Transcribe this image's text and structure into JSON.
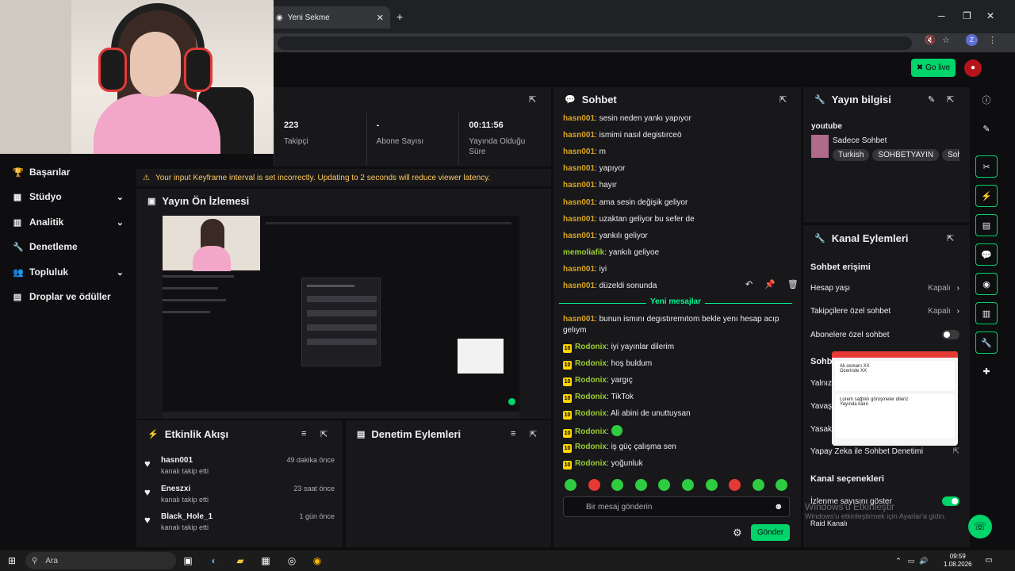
{
  "browser": {
    "tab_title": "Yeni Sekme",
    "profile_initial": "Z"
  },
  "topnav": {
    "go_live_label": "Go live"
  },
  "sidebar": {
    "items": [
      {
        "label": "Başarılar",
        "icon": "trophy-icon",
        "expandable": false
      },
      {
        "label": "Stüdyo",
        "icon": "studio-icon",
        "expandable": true
      },
      {
        "label": "Analitik",
        "icon": "chart-icon",
        "expandable": true
      },
      {
        "label": "Denetleme",
        "icon": "wrench-icon",
        "expandable": false
      },
      {
        "label": "Topluluk",
        "icon": "people-icon",
        "expandable": true
      },
      {
        "label": "Droplar ve ödüller",
        "icon": "drops-icon",
        "expandable": false
      }
    ]
  },
  "stats": [
    {
      "value": "223",
      "label": "Takipçi"
    },
    {
      "value": "-",
      "label": "Abone Sayısı"
    },
    {
      "value": "00:11:56",
      "label": "Yayında Olduğu Süre"
    }
  ],
  "warning": "Your input Keyframe interval is set incorrectly. Updating to 2 seconds will reduce viewer latency.",
  "preview": {
    "title": "Yayın Ön İzlemesi"
  },
  "activity": {
    "title": "Etkinlik Akışı",
    "items": [
      {
        "name": "hasn001",
        "sub": "kanalı takip etti",
        "time": "49 dakika önce"
      },
      {
        "name": "Eneszxi",
        "sub": "kanalı takip etti",
        "time": "23 saat önce"
      },
      {
        "name": "Black_Hole_1",
        "sub": "kanalı takip etti",
        "time": "1 gün önce"
      }
    ]
  },
  "moderation": {
    "title": "Denetim Eylemleri"
  },
  "chat": {
    "title": "Sohbet",
    "messages": [
      {
        "user": "hasn001",
        "text": "sesin neden yankı yapıyor",
        "color": "#daa520",
        "badge": false
      },
      {
        "user": "hasn001",
        "text": "ismimi nasıl degistırceö",
        "color": "#daa520",
        "badge": false
      },
      {
        "user": "hasn001",
        "text": "m",
        "color": "#daa520",
        "badge": false
      },
      {
        "user": "hasn001",
        "text": "yapıyor",
        "color": "#daa520",
        "badge": false
      },
      {
        "user": "hasn001",
        "text": "hayır",
        "color": "#daa520",
        "badge": false
      },
      {
        "user": "hasn001",
        "text": "ama sesin değişik geliyor",
        "color": "#daa520",
        "badge": false
      },
      {
        "user": "hasn001",
        "text": "uzaktan geliyor bu sefer de",
        "color": "#daa520",
        "badge": false
      },
      {
        "user": "hasn001",
        "text": "yankılı geliyor",
        "color": "#daa520",
        "badge": false
      },
      {
        "user": "memoliafik",
        "text": "yankılı geliyoe",
        "color": "#9acd32",
        "badge": false
      },
      {
        "user": "hasn001",
        "text": "iyi",
        "color": "#daa520",
        "badge": false
      },
      {
        "user": "hasn001",
        "text": "düzeldi sonunda",
        "color": "#daa520",
        "badge": false
      }
    ],
    "new_messages_label": "Yeni mesajlar",
    "new_messages": [
      {
        "user": "hasn001",
        "text": "bunun ismını degıstıremıtom bekle yenı hesap acıp gelıym",
        "badge": false
      },
      {
        "user": "Rodonix",
        "text": "iyi yayınlar dilerim",
        "badge": true
      },
      {
        "user": "Rodonix",
        "text": "hoş buldum",
        "badge": true
      },
      {
        "user": "Rodonix",
        "text": "yargıç",
        "badge": true
      },
      {
        "user": "Rodonix",
        "text": "TikTok",
        "badge": true
      },
      {
        "user": "Rodonix",
        "text": "Ali abini de unuttuysan",
        "badge": true
      },
      {
        "user": "Rodonix",
        "text": "",
        "badge": true
      },
      {
        "user": "Rodonix",
        "text": "iş güç çalışma sen",
        "badge": true
      },
      {
        "user": "Rodonix",
        "text": "yoğunluk",
        "badge": true
      }
    ],
    "badge_label": "10",
    "input_placeholder": "Bir mesaj gönderin",
    "send_label": "Gönder"
  },
  "stream_info": {
    "title": "Yayın bilgisi",
    "stream_title": "youtube",
    "category": "Sadece Sohbet",
    "tags": [
      "Turkish",
      "SOHBETYAYIN",
      "Sohbe"
    ]
  },
  "channel_actions": {
    "title": "Kanal Eylemleri",
    "chat_access_heading": "Sohbet erişimi",
    "settings": [
      {
        "label": "Hesap yaşı",
        "value": "Kapalı"
      },
      {
        "label": "Takipçilere özel sohbet",
        "value": "Kapalı"
      },
      {
        "label": "Abonelere özel sohbet",
        "value": ""
      }
    ],
    "partial_heading": "Sohbet",
    "partial_rows": [
      "Yalnız",
      "Yavaş",
      "Yasakl"
    ],
    "ai_moderation": "Yapay Zeka ile Sohbet Denetimi",
    "channel_options_heading": "Kanal seçenekleri",
    "viewer_count_label": "İzlenme sayısını göster",
    "raid_label": "Raid Kanalı"
  },
  "popup": {
    "lines": [
      "Ali osmanı XX",
      "Ozerinde XX",
      "Lorem sağlıklı görüşmeler dileriz",
      "Yayında kalın"
    ]
  },
  "watermark": {
    "title": "Windows'u Etkinleştir",
    "sub": "Windows'u etkinleştirmek için Ayarlar'a gidin."
  },
  "taskbar": {
    "search_label": "Ara",
    "time": "09:59",
    "date": "1.08.2026"
  }
}
